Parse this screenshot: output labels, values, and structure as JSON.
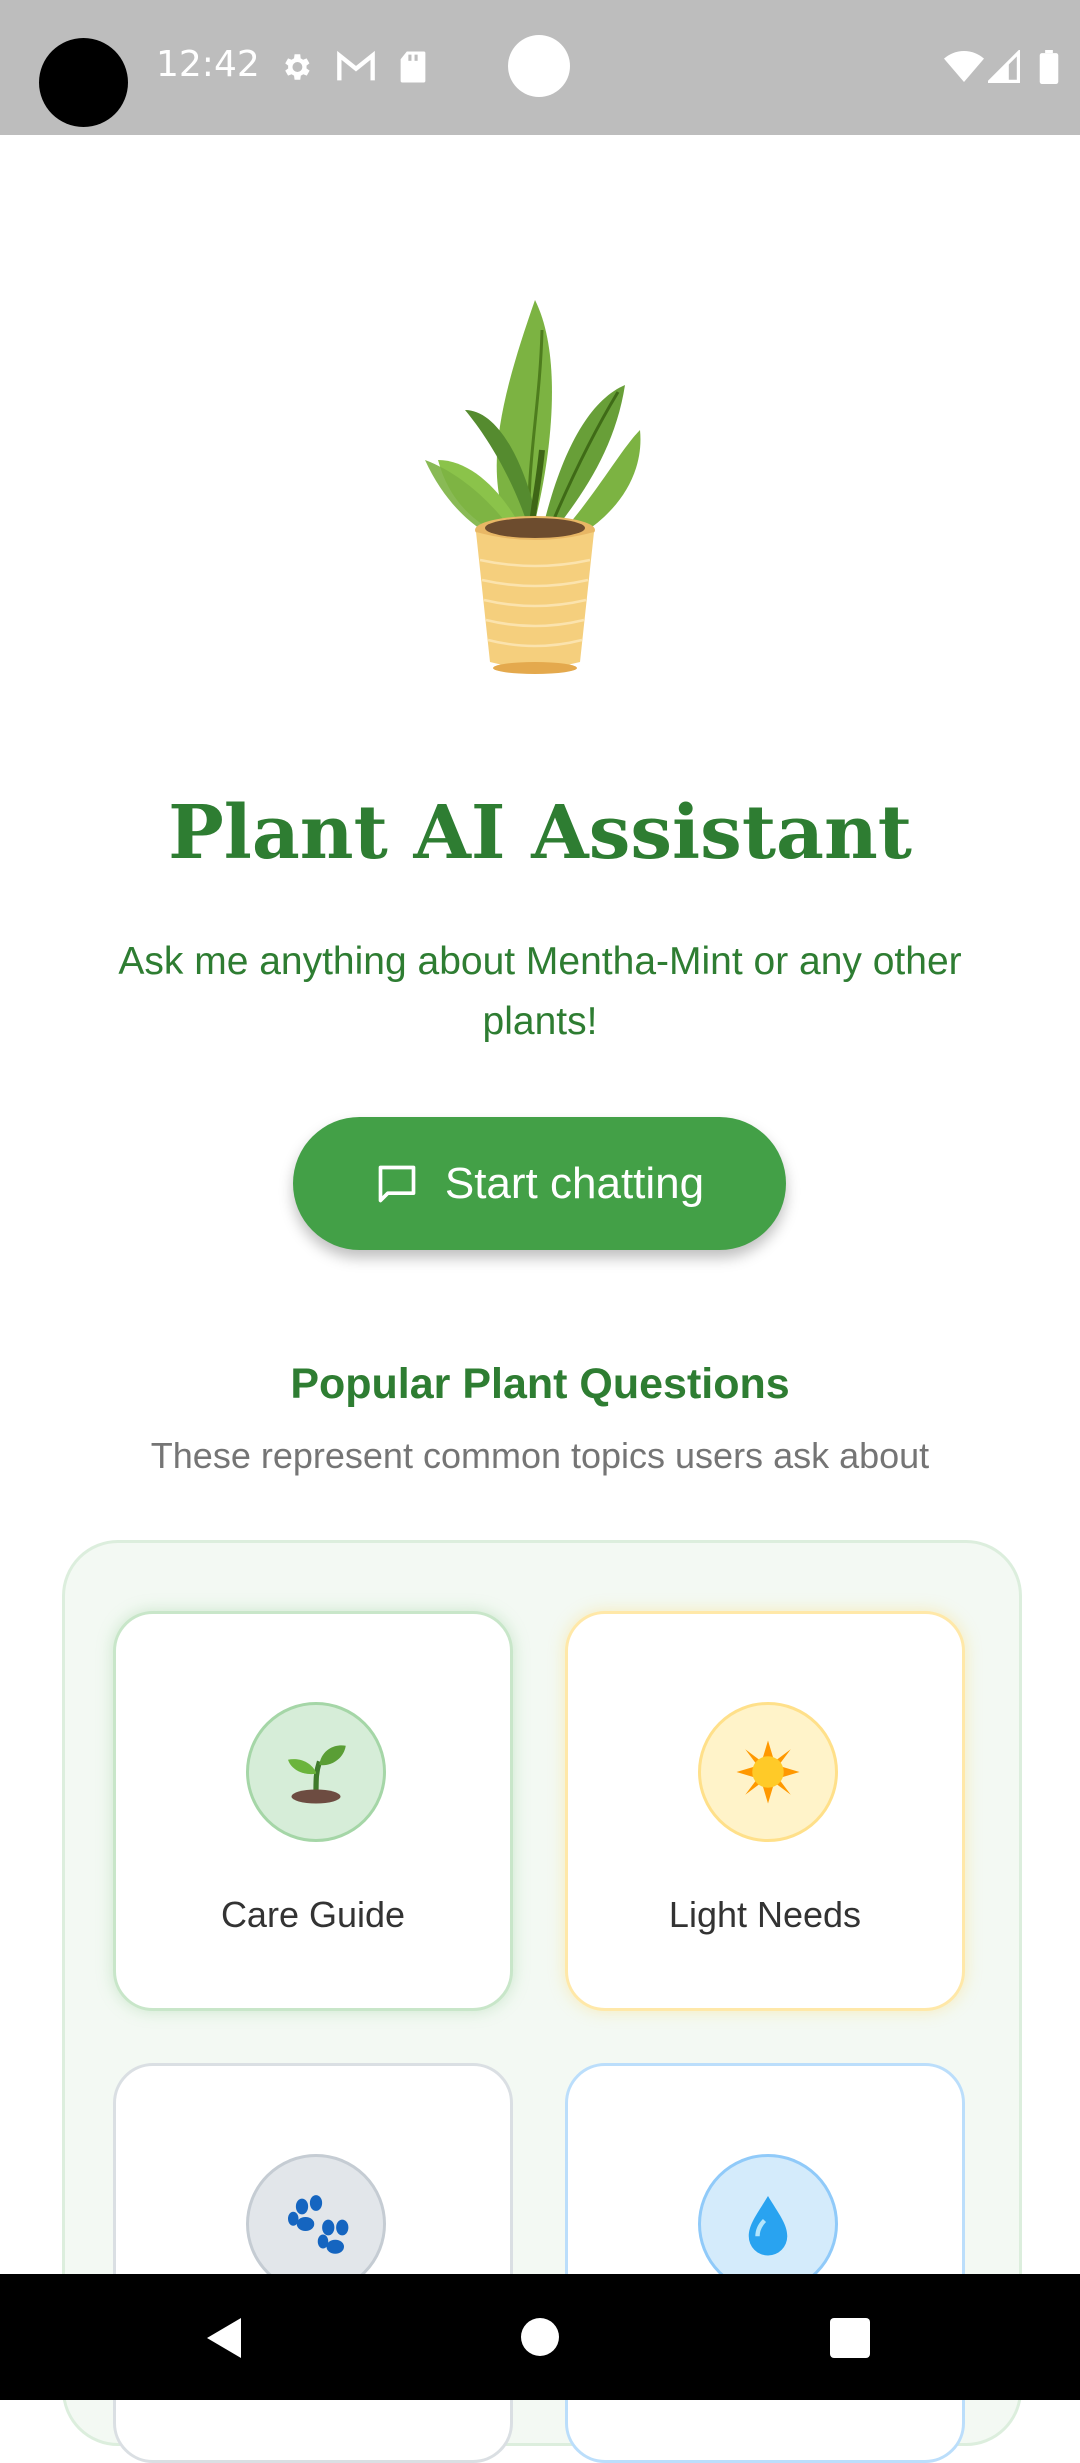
{
  "status_bar": {
    "time": "12:42"
  },
  "hero": {
    "title": "Plant AI Assistant",
    "subtitle": "Ask me anything about Mentha-Mint or any other plants!",
    "cta_label": "Start chatting"
  },
  "popular": {
    "title": "Popular Plant Questions",
    "subtitle": "These represent common topics users ask about",
    "cards": [
      {
        "label": "Care Guide",
        "icon": "seedling-icon"
      },
      {
        "label": "Light Needs",
        "icon": "sun-icon"
      },
      {
        "label": "",
        "icon": "paw-icon"
      },
      {
        "label": "",
        "icon": "water-drop-icon"
      }
    ]
  },
  "colors": {
    "brand_green": "#2e7d32",
    "button_green": "#43a047",
    "care_circle": "#d6edd8",
    "light_circle": "#fff3c9",
    "pet_circle": "#e2e6ea",
    "water_circle": "#d4ebfb"
  }
}
